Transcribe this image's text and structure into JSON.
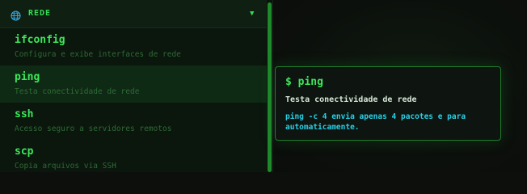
{
  "section": {
    "title": "REDE",
    "icon": "globe-icon",
    "toggle_icon": "caret-down-icon",
    "toggle_glyph": "▼"
  },
  "items": [
    {
      "name": "ifconfig",
      "desc": "Configura e exibe interfaces de rede",
      "active": false
    },
    {
      "name": "ping",
      "desc": "Testa conectividade de rede",
      "active": true
    },
    {
      "name": "ssh",
      "desc": "Acesso seguro a servidores remotos",
      "active": false
    },
    {
      "name": "scp",
      "desc": "Copia arquivos via SSH",
      "active": false
    }
  ],
  "tooltip": {
    "command": "$ ping",
    "description": "Testa conectividade de rede",
    "example": "ping -c 4 envia apenas 4 pacotes e para automaticamente."
  },
  "colors": {
    "accent": "#3ce85a",
    "desc": "#2e6b36",
    "example": "#27d0e8",
    "background": "#0c0f0c"
  }
}
